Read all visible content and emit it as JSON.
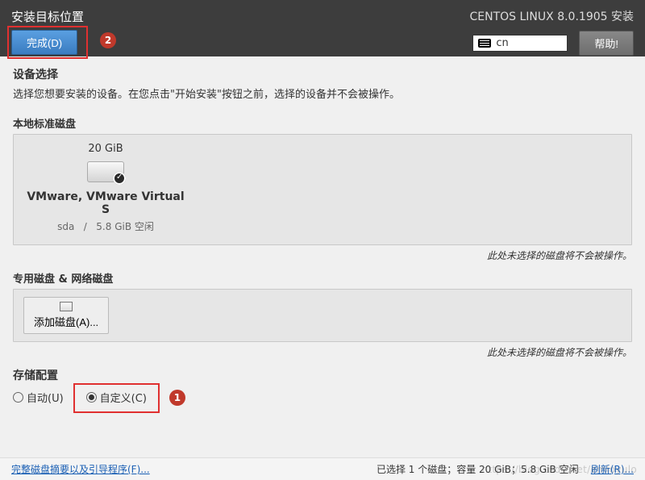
{
  "header": {
    "title": "安装目标位置",
    "subtitle": "CENTOS LINUX 8.0.1905 安装",
    "done_label": "完成(D)",
    "help_label": "帮助!",
    "kb_layout": "cn"
  },
  "device_select": {
    "title": "设备选择",
    "desc": "选择您想要安装的设备。在您点击\"开始安装\"按钮之前，选择的设备并不会被操作。"
  },
  "local_disks": {
    "heading": "本地标准磁盘",
    "disk": {
      "size": "20 GiB",
      "name": "VMware, VMware Virtual S",
      "dev": "sda",
      "sep": "/",
      "free": "5.8 GiB 空闲"
    },
    "note": "此处未选择的磁盘将不会被操作。"
  },
  "special_disks": {
    "heading": "专用磁盘 & 网络磁盘",
    "add_label": "添加磁盘(A)...",
    "note": "此处未选择的磁盘将不会被操作。"
  },
  "storage": {
    "heading": "存储配置",
    "auto_label": "自动(U)",
    "custom_label": "自定义(C)"
  },
  "footer": {
    "summary_link": "完整磁盘摘要以及引导程序(F)...",
    "status": "已选择 1 个磁盘；容量 20 GiB；5.8 GiB 空闲",
    "refresh_link": "刷新(R)..."
  },
  "annotations": {
    "step1": "1",
    "step2": "2"
  },
  "watermark": "https://blog.csdn.net/emloyulo"
}
